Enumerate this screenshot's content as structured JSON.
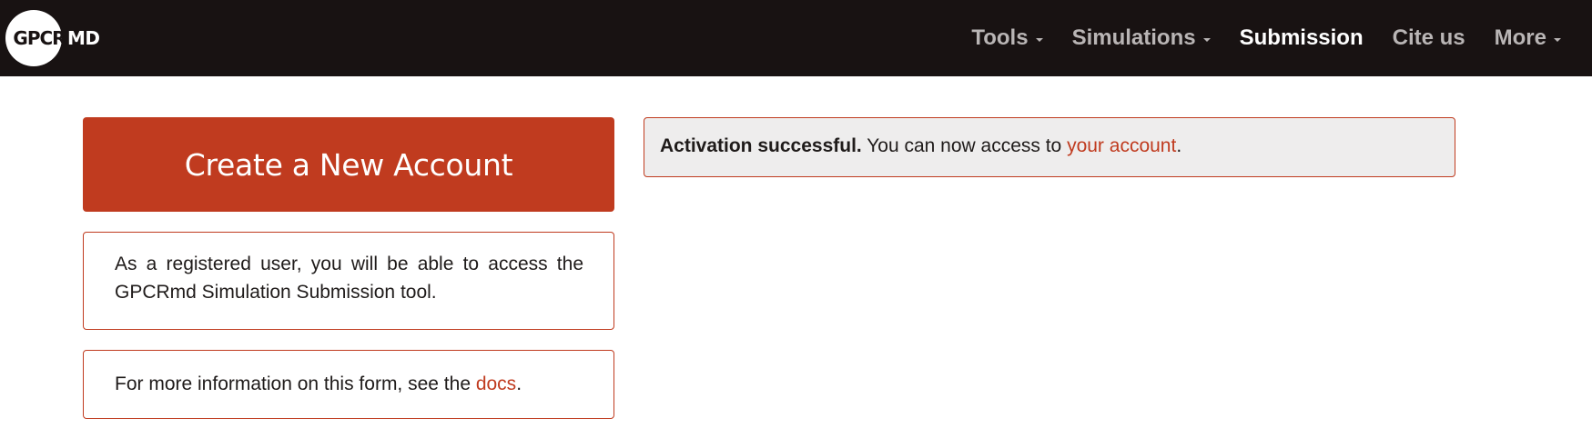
{
  "brand": {
    "logo_circle_text": "GPCR",
    "logo_suffix_text": "MD"
  },
  "nav": {
    "items": [
      {
        "label": "Tools",
        "dropdown": true,
        "active": false
      },
      {
        "label": "Simulations",
        "dropdown": true,
        "active": false
      },
      {
        "label": "Submission",
        "dropdown": false,
        "active": true
      },
      {
        "label": "Cite us",
        "dropdown": false,
        "active": false
      },
      {
        "label": "More",
        "dropdown": true,
        "active": false
      }
    ]
  },
  "create_account": {
    "title": "Create a New Account"
  },
  "info_panel": {
    "text": "As a registered user, you will be able to access the GPCRmd Simulation Submission tool."
  },
  "docs_panel": {
    "text_before": "For more information on this form, see the ",
    "link_label": "docs",
    "text_after": "."
  },
  "alert": {
    "bold_text": "Activation successful.",
    "text_before": " You can now access to ",
    "link_label": "your account",
    "text_after": "."
  },
  "colors": {
    "navbar_bg": "#181212",
    "accent": "#c03b1f",
    "nav_text": "#b9b5b5",
    "nav_active_text": "#ffffff",
    "alert_bg": "#eeeded"
  }
}
